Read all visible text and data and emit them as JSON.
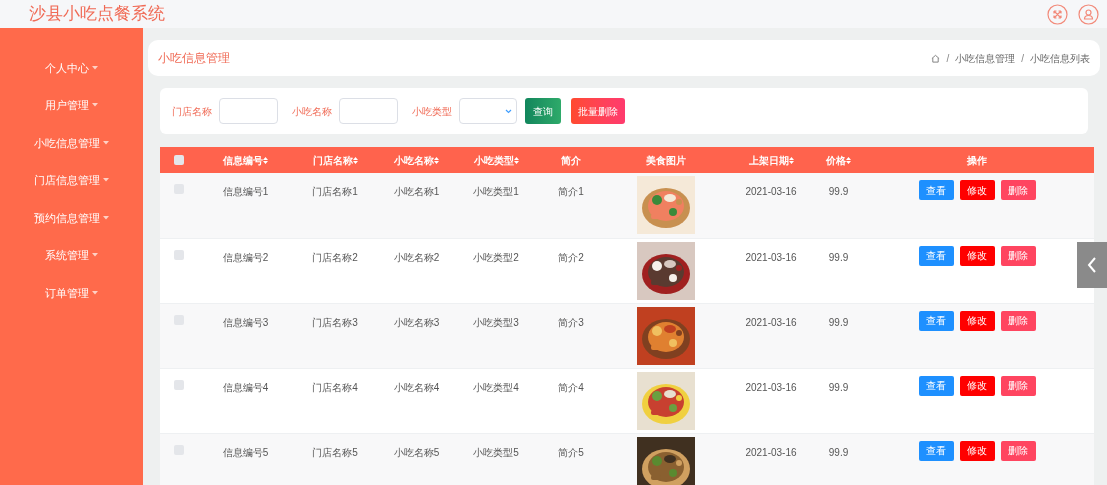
{
  "app_title": "沙县小吃点餐系统",
  "sidebar": {
    "items": [
      {
        "label": "个人中心"
      },
      {
        "label": "用户管理"
      },
      {
        "label": "小吃信息管理"
      },
      {
        "label": "门店信息管理"
      },
      {
        "label": "预约信息管理"
      },
      {
        "label": "系统管理"
      },
      {
        "label": "订单管理"
      }
    ]
  },
  "page_title": "小吃信息管理",
  "breadcrumb": [
    {
      "separator": "/",
      "label": "小吃信息管理"
    },
    {
      "separator": "/",
      "label": "小吃信息列表"
    }
  ],
  "search": {
    "fields": [
      {
        "label": "门店名称",
        "kind": "text"
      },
      {
        "label": "小吃名称",
        "kind": "text"
      },
      {
        "label": "小吃类型",
        "kind": "select"
      }
    ],
    "buttons": [
      {
        "label": "查询",
        "kind": "search"
      },
      {
        "label": "批量删除",
        "kind": "delete"
      }
    ]
  },
  "table": {
    "select_all_checked": false,
    "columns": [
      {
        "label": "信息编号",
        "sortable": true
      },
      {
        "label": "门店名称",
        "sortable": true
      },
      {
        "label": "小吃名称",
        "sortable": true
      },
      {
        "label": "小吃类型",
        "sortable": true
      },
      {
        "label": "简介",
        "sortable": false
      },
      {
        "label": "美食图片",
        "sortable": false
      },
      {
        "label": "上架日期",
        "sortable": true
      },
      {
        "label": "价格",
        "sortable": true
      },
      {
        "label": "操作",
        "sortable": false
      }
    ],
    "rows": [
      {
        "checked": false,
        "id": "信息编号1",
        "store": "门店名称1",
        "name": "小吃名称1",
        "type": "小吃类型1",
        "intro": "简介1",
        "date": "2021-03-16",
        "price": "99.9",
        "actions": [
          "查看",
          "修改",
          "删除"
        ]
      },
      {
        "checked": false,
        "id": "信息编号2",
        "store": "门店名称2",
        "name": "小吃名称2",
        "type": "小吃类型2",
        "intro": "简介2",
        "date": "2021-03-16",
        "price": "99.9",
        "actions": [
          "查看",
          "修改",
          "删除"
        ]
      },
      {
        "checked": false,
        "id": "信息编号3",
        "store": "门店名称3",
        "name": "小吃名称3",
        "type": "小吃类型3",
        "intro": "简介3",
        "date": "2021-03-16",
        "price": "99.9",
        "actions": [
          "查看",
          "修改",
          "删除"
        ]
      },
      {
        "checked": false,
        "id": "信息编号4",
        "store": "门店名称4",
        "name": "小吃名称4",
        "type": "小吃类型4",
        "intro": "简介4",
        "date": "2021-03-16",
        "price": "99.9",
        "actions": [
          "查看",
          "修改",
          "删除"
        ]
      },
      {
        "checked": false,
        "id": "信息编号5",
        "store": "门店名称5",
        "name": "小吃名称5",
        "type": "小吃类型5",
        "intro": "简介5",
        "date": "2021-03-16",
        "price": "99.9",
        "actions": [
          "查看",
          "修改",
          "删除"
        ]
      }
    ]
  }
}
